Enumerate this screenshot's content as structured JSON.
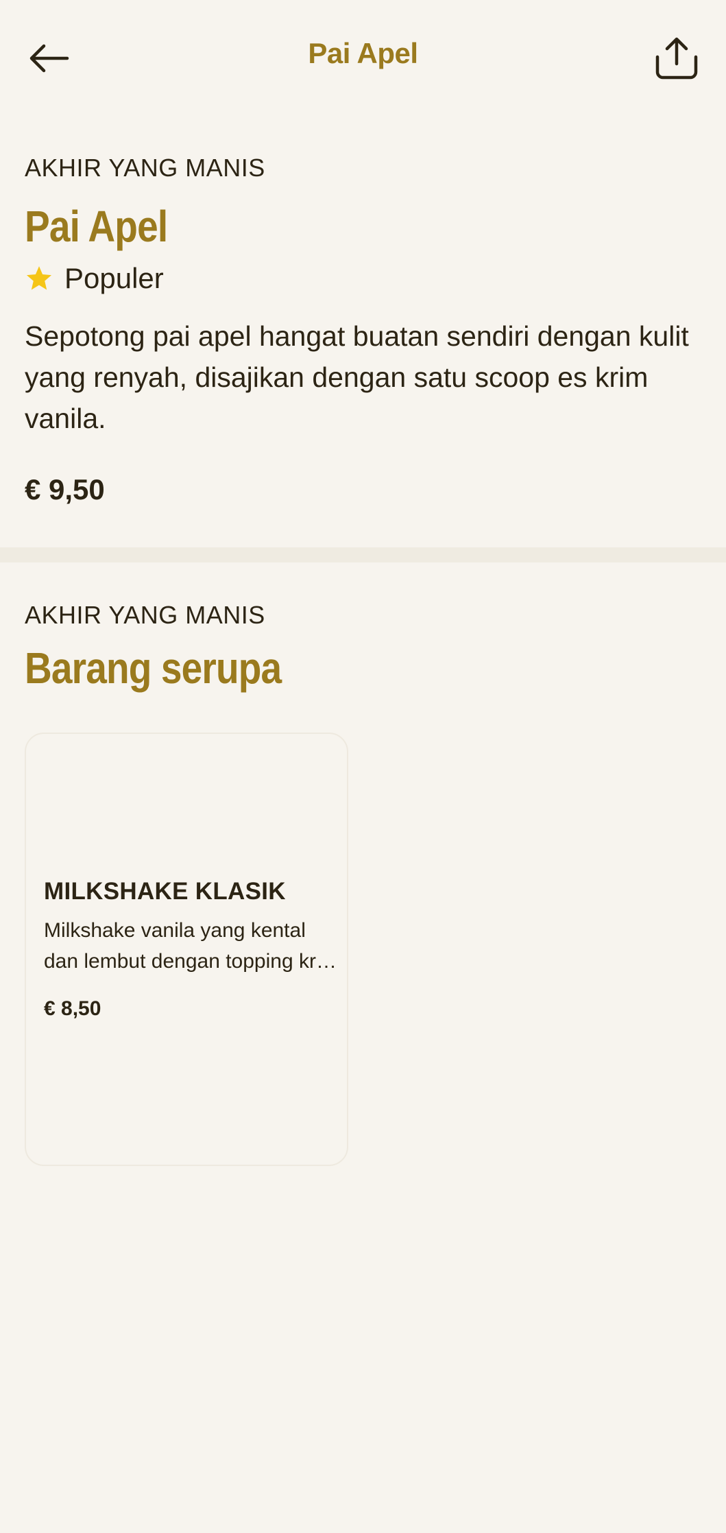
{
  "header": {
    "title": "Pai Apel",
    "back_icon": "arrow-left-icon",
    "share_icon": "share-upload-icon"
  },
  "item": {
    "category": "AKHIR YANG MANIS",
    "name": "Pai Apel",
    "badge": "Populer",
    "badge_icon": "star-icon",
    "description": "Sepotong pai apel hangat buatan sendiri dengan kulit yang renyah, disajikan dengan satu scoop es krim vanila.",
    "price": "€ 9,50"
  },
  "similar": {
    "category": "AKHIR YANG MANIS",
    "title": "Barang serupa",
    "cards": [
      {
        "name": "MILKSHAKE KLASIK",
        "description": "Milkshake vanila yang kental dan lembut dengan topping krim kocok.",
        "price": "€ 8,50"
      }
    ]
  },
  "colors": {
    "background": "#f7f4ee",
    "accent": "#9a7a1e",
    "text": "#2c2414",
    "star": "#f5c518",
    "divider": "#efebe1"
  }
}
